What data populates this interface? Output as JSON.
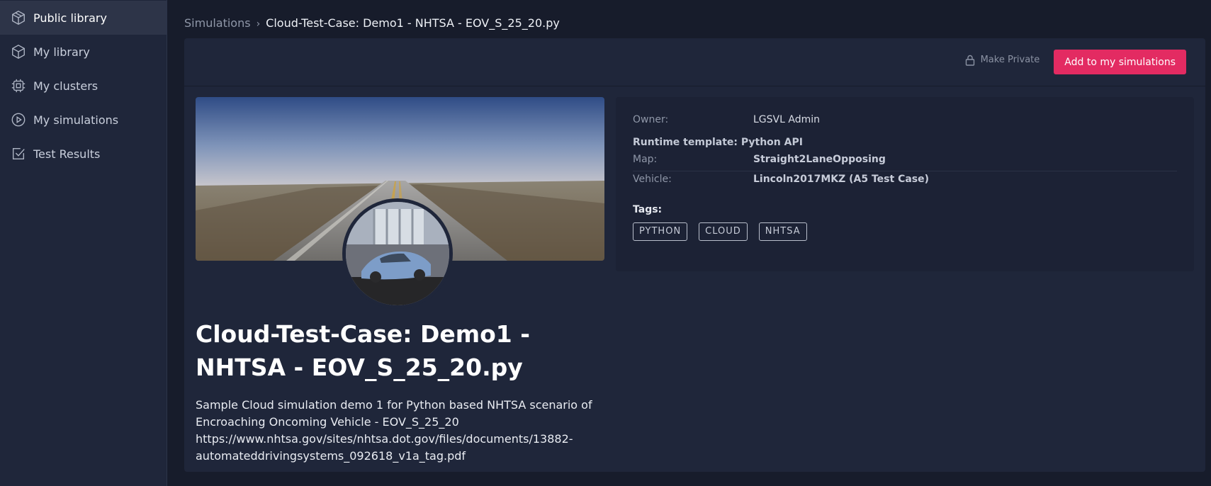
{
  "sidebar": {
    "items": [
      {
        "label": "Public library",
        "icon": "cube-outline-icon"
      },
      {
        "label": "My library",
        "icon": "cube-icon"
      },
      {
        "label": "My clusters",
        "icon": "chip-icon"
      },
      {
        "label": "My simulations",
        "icon": "play-circle-icon"
      },
      {
        "label": "Test Results",
        "icon": "checkbox-icon"
      }
    ]
  },
  "breadcrumb": {
    "parent": "Simulations",
    "separator": "›",
    "current": "Cloud-Test-Case: Demo1 - NHTSA - EOV_S_25_20.py"
  },
  "actions": {
    "make_private": "Make Private",
    "add_button": "Add to my simulations"
  },
  "simulation": {
    "title": "Cloud-Test-Case: Demo1 - NHTSA - EOV_S_25_20.py",
    "description_line1": "Sample Cloud simulation demo 1 for Python based NHTSA scenario of",
    "description_line2": "Encroaching Oncoming Vehicle - EOV_S_25_20",
    "description_line3": "https://www.nhtsa.gov/sites/nhtsa.dot.gov/files/documents/13882-",
    "description_line4": "automateddrivingsystems_092618_v1a_tag.pdf"
  },
  "info": {
    "owner_label": "Owner:",
    "owner_value": "LGSVL Admin",
    "runtime": "Runtime template: Python API",
    "map_label": "Map:",
    "map_value": "Straight2LaneOpposing",
    "vehicle_label": "Vehicle:",
    "vehicle_value": "Lincoln2017MKZ (A5 Test Case)",
    "tags_label": "Tags:",
    "tags": [
      "PYTHON",
      "CLOUD",
      "NHTSA"
    ]
  },
  "colors": {
    "accent": "#e32b62",
    "sidebar_bg": "#1f263a",
    "page_bg": "#171c2b"
  }
}
